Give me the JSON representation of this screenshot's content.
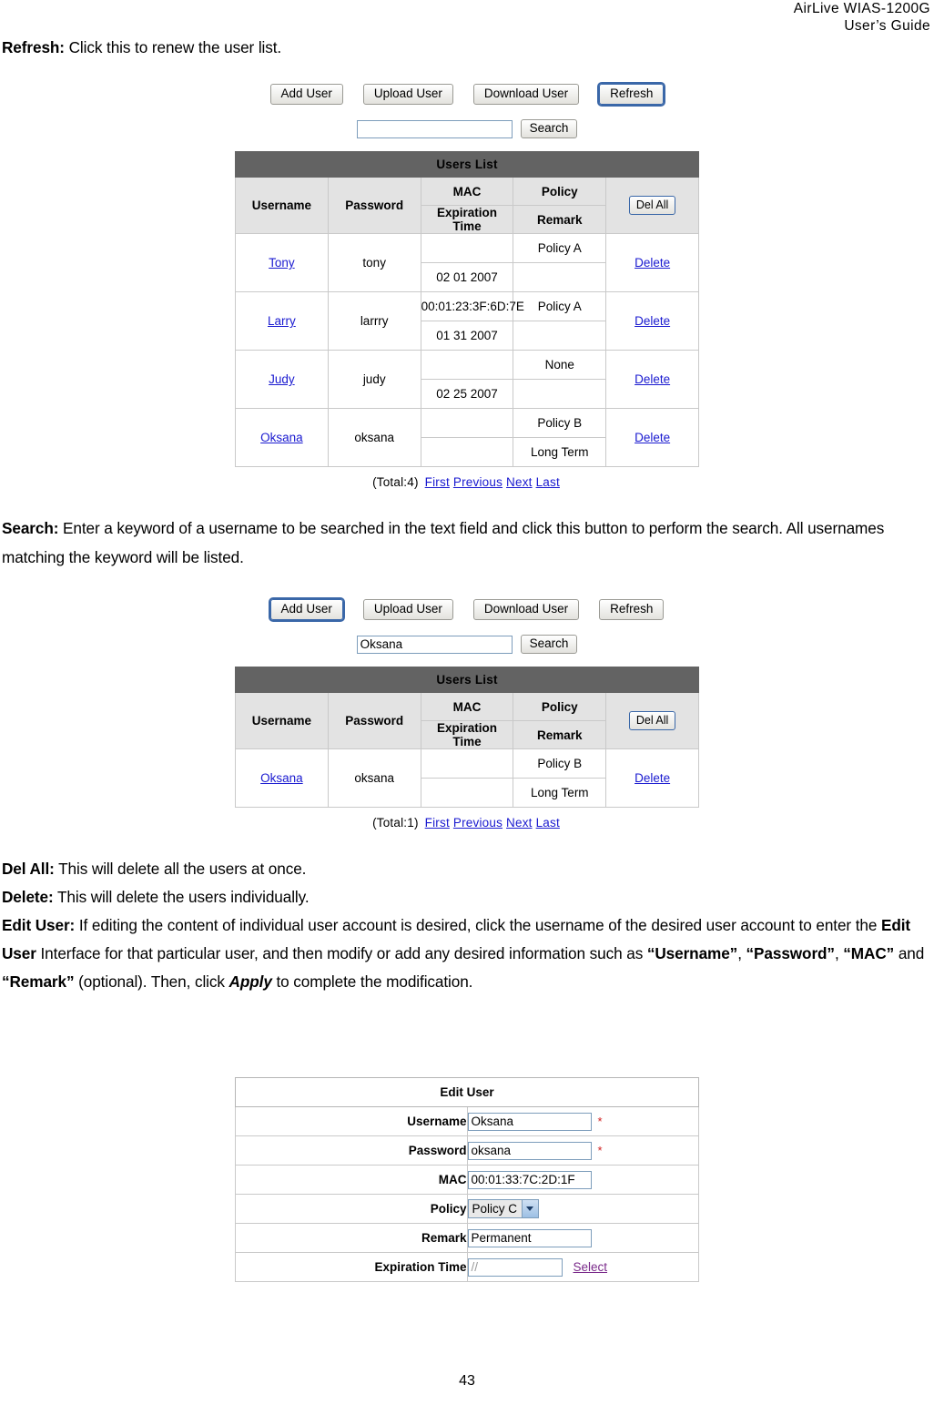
{
  "header": {
    "line1": "AirLive  WIAS-1200G",
    "line2": "User’s  Guide"
  },
  "paragraphs": {
    "refresh_label": "Refresh:",
    "refresh_text": " Click this to renew the user list.",
    "search_label": "Search:",
    "search_text": " Enter a keyword of a username to be searched in the text field and click this button to perform the search. All usernames matching the keyword will be listed.",
    "delall_label": "Del All:",
    "delall_text": " This will delete all the users at once.",
    "delete_label": "Delete:",
    "delete_text": " This will delete the users individually.",
    "edituser_label": "Edit User:",
    "edituser_p1": " If editing the content of individual user account is desired, click the username of the desired user account to enter the ",
    "edituser_b1": "Edit User",
    "edituser_p2": " Interface for that particular user, and then modify or add any desired information such as ",
    "edituser_b2": "“Username”",
    "edituser_sep1": ", ",
    "edituser_b3": "“Password”",
    "edituser_sep2": ", ",
    "edituser_b4": "“MAC”",
    "edituser_sep3": " and ",
    "edituser_b5": "“Remark”",
    "edituser_p3": " (optional). Then, click ",
    "edituser_apply": "Apply",
    "edituser_p4": " to complete the modification."
  },
  "toolbar": {
    "add_user": "Add User",
    "upload_user": "Upload User",
    "download_user": "Download User",
    "refresh": "Refresh",
    "search_button": "Search"
  },
  "screenshot1": {
    "search_value": "",
    "focused_button": "Refresh",
    "table": {
      "title": "Users List",
      "headers": {
        "username": "Username",
        "password": "Password",
        "mac": "MAC",
        "policy": "Policy",
        "expiration_time": "Expiration Time",
        "remark": "Remark",
        "del_all": "Del All"
      },
      "rows": [
        {
          "username": "Tony",
          "password": "tony",
          "mac": "",
          "policy": "Policy A",
          "expiration_time": "02 01 2007",
          "remark": "",
          "action": "Delete"
        },
        {
          "username": "Larry",
          "password": "larrry",
          "mac": "00:01:23:3F:6D:7E",
          "policy": "Policy A",
          "expiration_time": "01 31 2007",
          "remark": "",
          "action": "Delete"
        },
        {
          "username": "Judy",
          "password": "judy",
          "mac": "",
          "policy": "None",
          "expiration_time": "02 25 2007",
          "remark": "",
          "action": "Delete"
        },
        {
          "username": "Oksana",
          "password": "oksana",
          "mac": "",
          "policy": "Policy B",
          "expiration_time": "",
          "remark": "Long Term",
          "action": "Delete"
        }
      ],
      "pager": {
        "total": "(Total:4)",
        "first": "First",
        "previous": "Previous",
        "next": "Next",
        "last": "Last"
      }
    }
  },
  "screenshot2": {
    "search_value": "Oksana",
    "focused_button": "Add User",
    "table": {
      "title": "Users List",
      "headers": {
        "username": "Username",
        "password": "Password",
        "mac": "MAC",
        "policy": "Policy",
        "expiration_time": "Expiration Time",
        "remark": "Remark",
        "del_all": "Del All"
      },
      "rows": [
        {
          "username": "Oksana",
          "password": "oksana",
          "mac": "",
          "policy": "Policy B",
          "expiration_time": "",
          "remark": "Long Term",
          "action": "Delete"
        }
      ],
      "pager": {
        "total": "(Total:1)",
        "first": "First",
        "previous": "Previous",
        "next": "Next",
        "last": "Last"
      }
    }
  },
  "edit_user_form": {
    "title": "Edit User",
    "fields": {
      "username_label": "Username",
      "username_value": "Oksana",
      "username_required": "*",
      "password_label": "Password",
      "password_value": "oksana",
      "password_required": "*",
      "mac_label": "MAC",
      "mac_value": "00:01:33:7C:2D:1F",
      "policy_label": "Policy",
      "policy_value": "Policy C",
      "remark_label": "Remark",
      "remark_value": "Permanent",
      "expiration_label": "Expiration Time",
      "expiration_value": "//",
      "select_link": "Select"
    }
  },
  "footer": {
    "page_number": "43"
  },
  "colors": {
    "title_bar": "#636363",
    "header_cell": "#e3e3e3",
    "edit_title_bar": "#cccccc",
    "link": "#1a1ad0",
    "select_link": "#7a2a8a",
    "required": "#d02020"
  }
}
